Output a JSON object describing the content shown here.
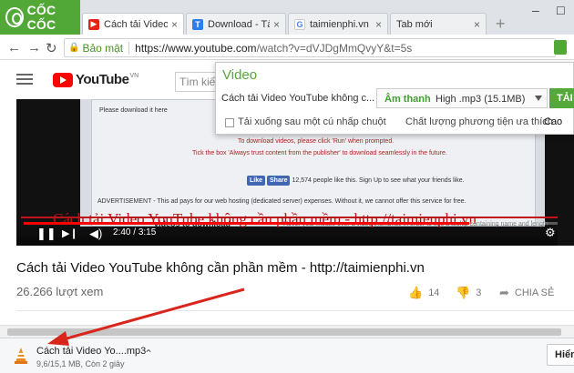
{
  "browser": {
    "brand": "CỐC CỐC",
    "tabs": [
      {
        "label": "Cách tải Video Yo",
        "favicon": "youtube-icon",
        "color": "#e62117"
      },
      {
        "label": "Download - Tải P",
        "favicon": "T-icon",
        "color": "#2b7de9"
      },
      {
        "label": "taimienphi.vn - T",
        "favicon": "google-icon",
        "color": "#4285f4"
      },
      {
        "label": "Tab mới",
        "favicon": "",
        "color": ""
      }
    ],
    "address": {
      "secure_label": "Bảo mật",
      "url_host": "https://www.youtube.com",
      "url_path": "/watch?v=dVJDgMmQvyY&t=5s"
    }
  },
  "youtube": {
    "logo": "YouTube",
    "region": "VN",
    "search_placeholder": "Tìm kiế"
  },
  "video": {
    "frame_texts": {
      "download_here": "Please download it here",
      "to_download": "To download videos, please click 'Run' when prompted.",
      "tick_box": "Tick the box 'Always trust content from the publisher' to download seamlessly in the future.",
      "fb_like": "Like",
      "fb_share": "Share",
      "fb_count": "12,574 people like this. Sign Up to see what your friends like.",
      "advert": "ADVERTISEMENT - This ad pays for our web hosting (dedicated server) expenses. Without it, we cannot offer this service for free.",
      "videos_download": "videos to download",
      "hover_tip": "Hover your mouse over a video thumbnail in order to see a tooltip containing name and length"
    },
    "overlay_title": "Cách tải Video YouTube không cần phần mềm - http://taimienphi.vn",
    "time_current": "2:40",
    "time_total": "3:15",
    "progress": 0.82
  },
  "popup": {
    "title": "Video",
    "video_title": "Cách tải Video YouTube không c...",
    "quality_type": "Âm thanh",
    "quality_value": "High .mp3 (15.1MB)",
    "download_button": "TẢI",
    "auto_download_label": "Tải xuống sau một cú nhấp chuột",
    "quality_pref_label": "Chất lượng phương tiện ưa thích",
    "quality_pref_value": "Cao"
  },
  "info": {
    "title": "Cách tải Video YouTube không cần phần mềm - http://taimienphi.vn",
    "views": "26.266 lượt xem",
    "likes": "14",
    "dislikes": "3",
    "share": "CHIA SẺ"
  },
  "download_shelf": {
    "file_name": "Cách tải Video Yo....mp3",
    "status": "9,6/15,1 MB, Còn 2 giây",
    "show_all": "Hiển"
  },
  "colors": {
    "brand_green": "#51a836",
    "youtube_red": "#ff0000",
    "annotation_red": "#d9261c"
  }
}
